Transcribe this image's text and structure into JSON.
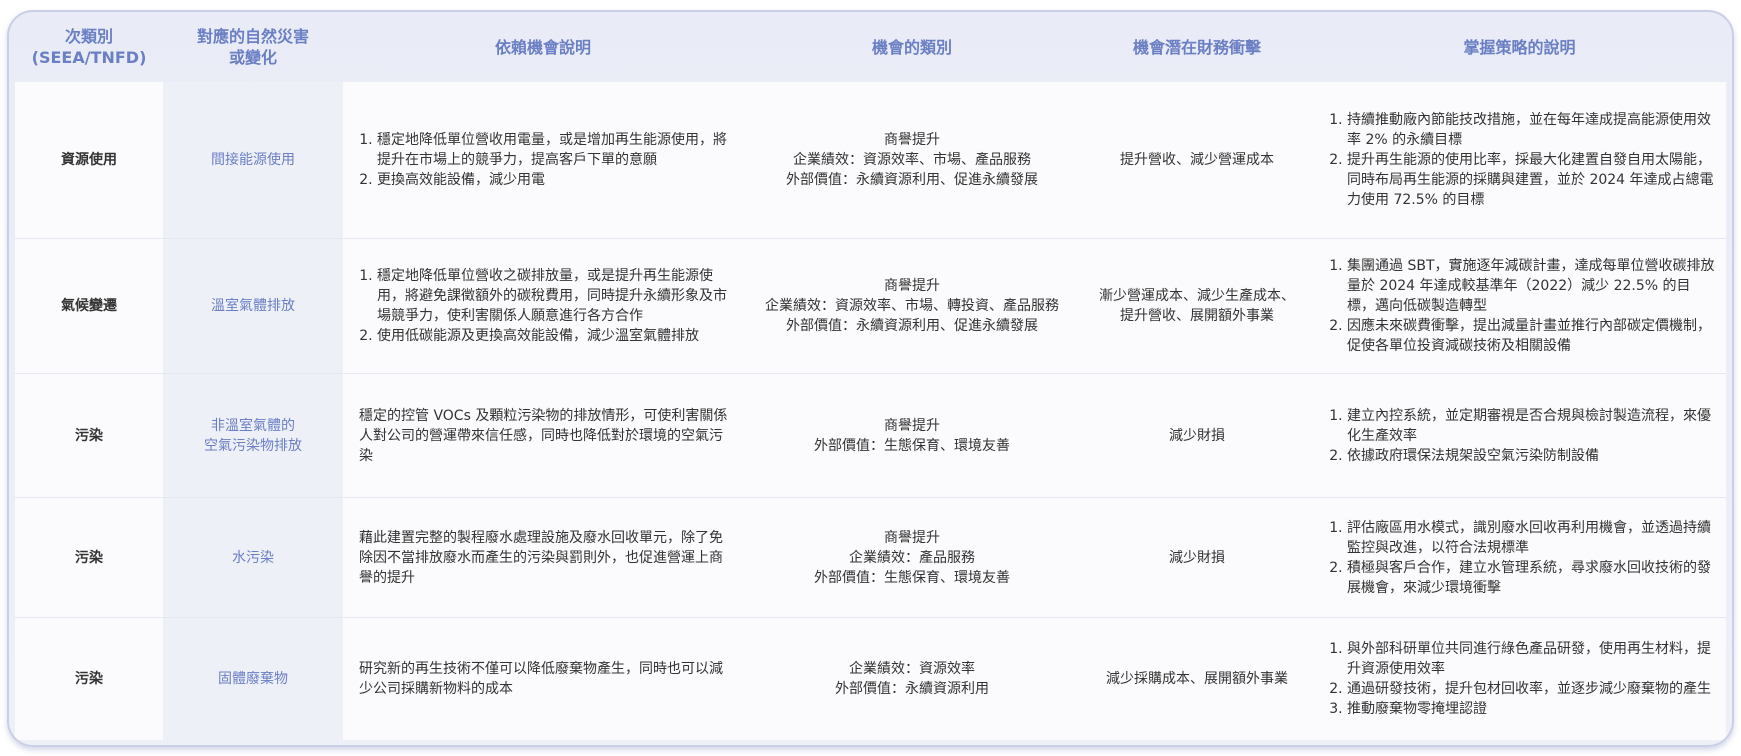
{
  "headers": {
    "subcategory": "次類別\n(SEEA/TNFD)",
    "hazard": "對應的自然災害\n或變化",
    "dependency": "依賴機會說明",
    "opp_type": "機會的類別",
    "impact": "機會潛在財務衝擊",
    "strategy": "掌握策略的說明"
  },
  "rows": [
    {
      "subcategory": "資源使用",
      "hazard": "間接能源使用",
      "dependency_list": [
        "穩定地降低單位營收用電量，或是增加再生能源使用，將提升在市場上的競爭力，提高客戶下單的意願",
        "更換高效能設備，減少用電"
      ],
      "opp_type": [
        "商譽提升",
        "企業績效：資源效率、市場、產品服務",
        "外部價值：永續資源利用、促進永續發展"
      ],
      "impact": [
        "提升營收、減少營運成本"
      ],
      "strategy_list": [
        "持續推動廠內節能技改措施，並在每年達成提高能源使用效率 2% 的永續目標",
        "提升再生能源的使用比率，採最大化建置自發自用太陽能，同時布局再生能源的採購與建置，並於 2024 年達成占總電力使用 72.5% 的目標"
      ]
    },
    {
      "subcategory": "氣候變遷",
      "hazard": "溫室氣體排放",
      "dependency_list": [
        "穩定地降低單位營收之碳排放量，或是提升再生能源使用，將避免課徵額外的碳稅費用，同時提升永續形象及市場競爭力，使利害關係人願意進行各方合作",
        "使用低碳能源及更換高效能設備，減少溫室氣體排放"
      ],
      "opp_type": [
        "商譽提升",
        "企業績效：資源效率、市場、轉投資、產品服務",
        "外部價值：永續資源利用、促進永續發展"
      ],
      "impact": [
        "漸少營運成本、減少生產成本、",
        "提升營收、展開額外事業"
      ],
      "strategy_list": [
        "集團通過 SBT，實施逐年減碳計畫，達成每單位營收碳排放量於 2024 年達成較基準年（2022）減少 22.5% 的目標，邁向低碳製造轉型",
        "因應未來碳費衝擊，提出減量計畫並推行內部碳定價機制，促使各單位投資減碳技術及相關設備"
      ]
    },
    {
      "subcategory": "污染",
      "hazard": "非溫室氣體的\n空氣污染物排放",
      "dependency_text": "穩定的控管 VOCs 及顆粒污染物的排放情形，可使利害關係人對公司的營運帶來信任感，同時也降低對於環境的空氣污染",
      "opp_type": [
        "商譽提升",
        "外部價值：生態保育、環境友善"
      ],
      "impact": [
        "減少財損"
      ],
      "strategy_list": [
        "建立內控系統，並定期審視是否合規與檢討製造流程，來優化生產效率",
        "依據政府環保法規架設空氣污染防制設備"
      ]
    },
    {
      "subcategory": "污染",
      "hazard": "水污染",
      "dependency_text": "藉此建置完整的製程廢水處理設施及廢水回收單元，除了免除因不當排放廢水而產生的污染與罰則外，也促進營運上商譽的提升",
      "opp_type": [
        "商譽提升",
        "企業績效：產品服務",
        "外部價值：生態保育、環境友善"
      ],
      "impact": [
        "減少財損"
      ],
      "strategy_list": [
        "評估廠區用水模式，識別廢水回收再利用機會，並透過持續監控與改進，以符合法規標準",
        "積極與客戶合作，建立水管理系統，尋求廢水回收技術的發展機會，來減少環境衝擊"
      ]
    },
    {
      "subcategory": "污染",
      "hazard": "固體廢棄物",
      "dependency_text": "研究新的再生技術不僅可以降低廢棄物產生，同時也可以減少公司採購新物料的成本",
      "opp_type": [
        "企業績效：資源效率",
        "外部價值：永續資源利用"
      ],
      "impact": [
        "減少採購成本、展開額外事業"
      ],
      "strategy_list": [
        "與外部科研單位共同進行綠色產品研發，使用再生材料，提升資源使用效率",
        "通過研發技術，提升包材回收率，並逐步減少廢棄物的產生",
        "推動廢棄物零掩埋認證"
      ]
    }
  ]
}
